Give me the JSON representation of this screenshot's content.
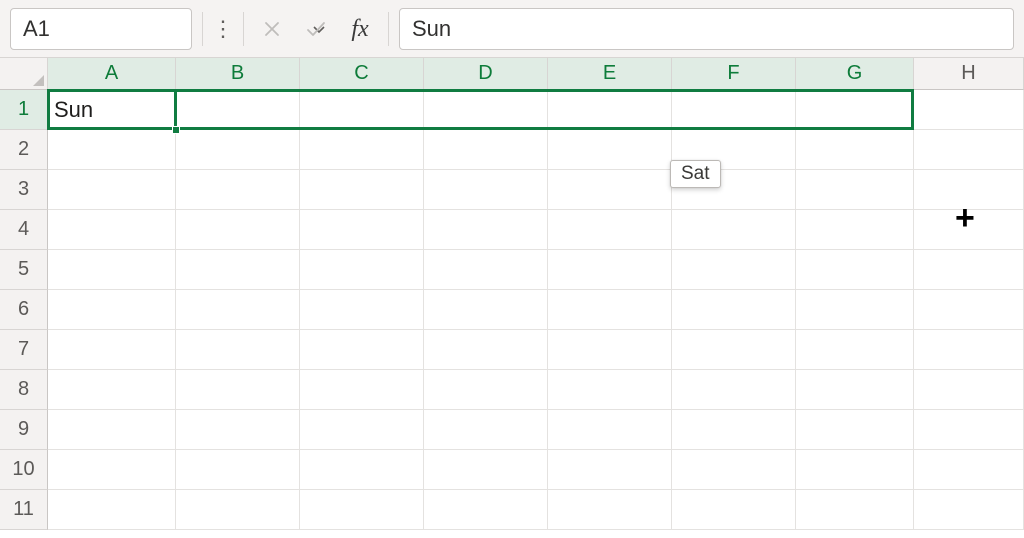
{
  "namebox": {
    "value": "A1"
  },
  "formula": {
    "value": "Sun"
  },
  "fx_label": "fx",
  "columns": [
    "A",
    "B",
    "C",
    "D",
    "E",
    "F",
    "G",
    "H"
  ],
  "rows": [
    "1",
    "2",
    "3",
    "4",
    "5",
    "6",
    "7",
    "8",
    "9",
    "10",
    "11"
  ],
  "cells": {
    "A1": "Sun"
  },
  "autofill_tooltip": "Sat",
  "cursor_glyph": "+",
  "selection": {
    "range": "A1:G1",
    "active": "A1"
  },
  "colors": {
    "accent": "#107c41"
  }
}
